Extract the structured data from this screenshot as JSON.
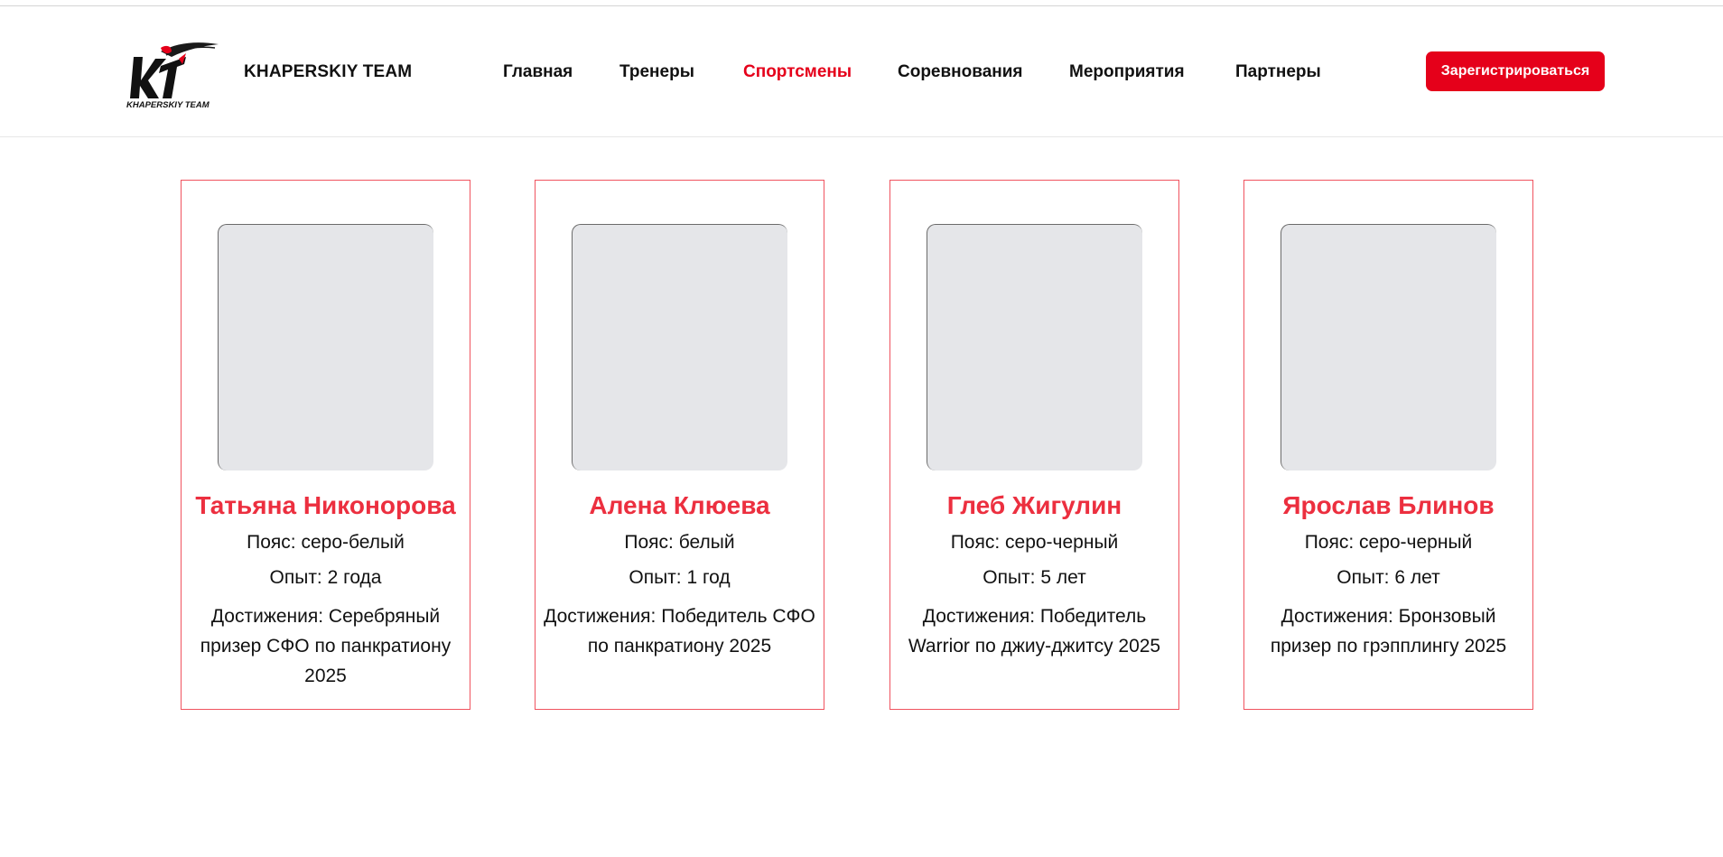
{
  "header": {
    "brand": "KHAPERSKIY TEAM",
    "logo_text": "KHAPERSKIY TEAM",
    "nav": [
      {
        "label": "Главная",
        "active": false
      },
      {
        "label": "Тренеры",
        "active": false
      },
      {
        "label": "Спортсмены",
        "active": true
      },
      {
        "label": "Соревнования",
        "active": false
      },
      {
        "label": "Мероприятия",
        "active": false
      },
      {
        "label": "Партнеры",
        "active": false
      }
    ],
    "register_label": "Зарегистрироваться"
  },
  "colors": {
    "accent": "#e5001a",
    "name": "#ec2f3f",
    "card_border": "#f0535f",
    "photo_placeholder": "#e5e6e9"
  },
  "athletes": [
    {
      "name": "Татьяна Никонорова",
      "belt": "Пояс: серо-белый",
      "experience": "Опыт: 2 года",
      "achievements": "Достижения: Серебряный призер СФО по панкратиону 2025"
    },
    {
      "name": "Алена Клюева",
      "belt": "Пояс: белый",
      "experience": "Опыт: 1 год",
      "achievements": "Достижения: Победитель СФО по панкратиону 2025"
    },
    {
      "name": "Глеб Жигулин",
      "belt": "Пояс: серо-черный",
      "experience": "Опыт: 5 лет",
      "achievements": "Достижения: Победитель Warrior по джиу-джитсу 2025"
    },
    {
      "name": "Ярослав Блинов",
      "belt": "Пояс: серо-черный",
      "experience": "Опыт: 6 лет",
      "achievements": "Достижения: Бронзовый призер по грэпплингу 2025"
    }
  ]
}
